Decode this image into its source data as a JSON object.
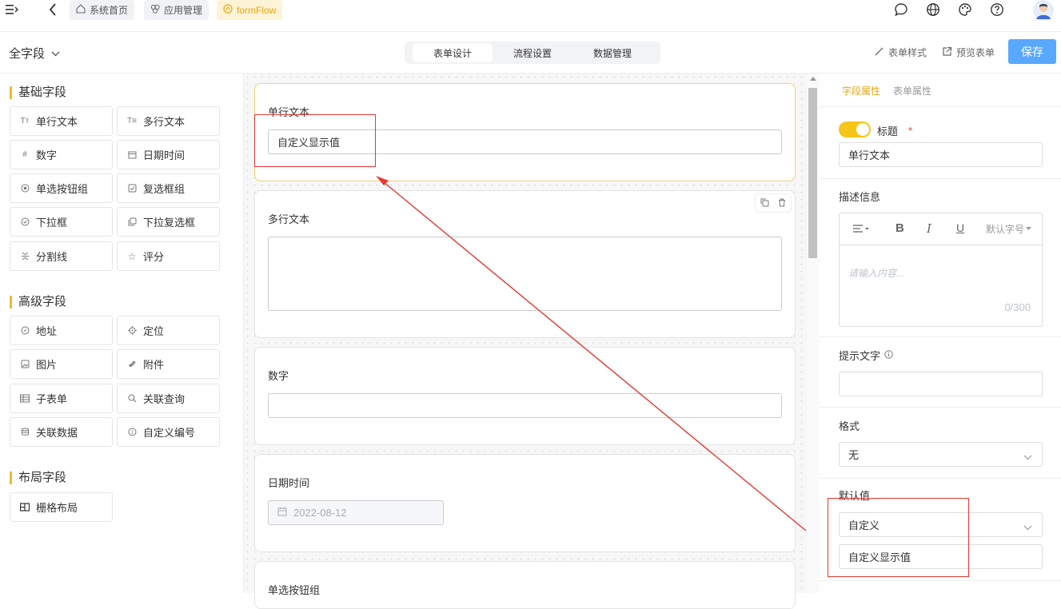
{
  "topbar": {
    "menu_icon": "menu-collapse-icon",
    "back_icon": "chevron-left-icon",
    "tabs": [
      {
        "label": "系统首页",
        "icon": "home-icon"
      },
      {
        "label": "应用管理",
        "icon": "apps-icon"
      },
      {
        "label": "formFlow",
        "icon": "form-flow-icon"
      }
    ],
    "right_icons": [
      "message-icon",
      "globe-icon",
      "palette-icon",
      "help-icon",
      "avatar"
    ]
  },
  "toolbar": {
    "field_selector": "全字段",
    "tabs": [
      "表单设计",
      "流程设置",
      "数据管理"
    ],
    "active_tab": "表单设计",
    "form_style": "表单样式",
    "preview": "预览表单",
    "save": "保存"
  },
  "left_panel": {
    "groups": [
      {
        "title": "基础字段",
        "items": [
          {
            "label": "单行文本",
            "icon": "text-icon"
          },
          {
            "label": "多行文本",
            "icon": "multiline-text-icon"
          },
          {
            "label": "数字",
            "icon": "hash-icon"
          },
          {
            "label": "日期时间",
            "icon": "calendar-icon"
          },
          {
            "label": "单选按钮组",
            "icon": "radio-icon"
          },
          {
            "label": "复选框组",
            "icon": "checkbox-icon"
          },
          {
            "label": "下拉框",
            "icon": "dropdown-icon"
          },
          {
            "label": "下拉复选框",
            "icon": "multi-dropdown-icon"
          },
          {
            "label": "分割线",
            "icon": "divider-icon"
          },
          {
            "label": "评分",
            "icon": "star-icon"
          }
        ]
      },
      {
        "title": "高级字段",
        "items": [
          {
            "label": "地址",
            "icon": "compass-icon"
          },
          {
            "label": "定位",
            "icon": "location-icon"
          },
          {
            "label": "图片",
            "icon": "image-icon"
          },
          {
            "label": "附件",
            "icon": "paperclip-icon"
          },
          {
            "label": "子表单",
            "icon": "table-icon"
          },
          {
            "label": "关联查询",
            "icon": "search-icon"
          },
          {
            "label": "关联数据",
            "icon": "database-icon"
          },
          {
            "label": "自定义编号",
            "icon": "serial-number-icon"
          }
        ]
      },
      {
        "title": "布局字段",
        "items": [
          {
            "label": "栅格布局",
            "icon": "grid-layout-icon"
          }
        ]
      }
    ]
  },
  "canvas": {
    "cards": [
      {
        "label": "单行文本",
        "value": "自定义显示值"
      },
      {
        "label": "多行文本",
        "value": ""
      },
      {
        "label": "数字",
        "value": ""
      },
      {
        "label": "日期时间",
        "value": "2022-08-12"
      },
      {
        "label": "单选按钮组"
      }
    ]
  },
  "right_panel": {
    "tabs": [
      "字段属性",
      "表单属性"
    ],
    "active_tab": "字段属性",
    "title_label": "标题",
    "title_required_mark": "*",
    "title_value": "单行文本",
    "desc_label": "描述信息",
    "editor_font_size": "默认字号",
    "editor_placeholder": "请输入内容...",
    "editor_count": "0/300",
    "hint_label": "提示文字",
    "hint_value": "",
    "format_label": "格式",
    "format_value": "无",
    "default_label": "默认值",
    "default_mode": "自定义",
    "default_value": "自定义显示值"
  },
  "colors": {
    "accent": "#f5b82e",
    "save_button": "#59a8ff",
    "annotation": "#e53935"
  }
}
